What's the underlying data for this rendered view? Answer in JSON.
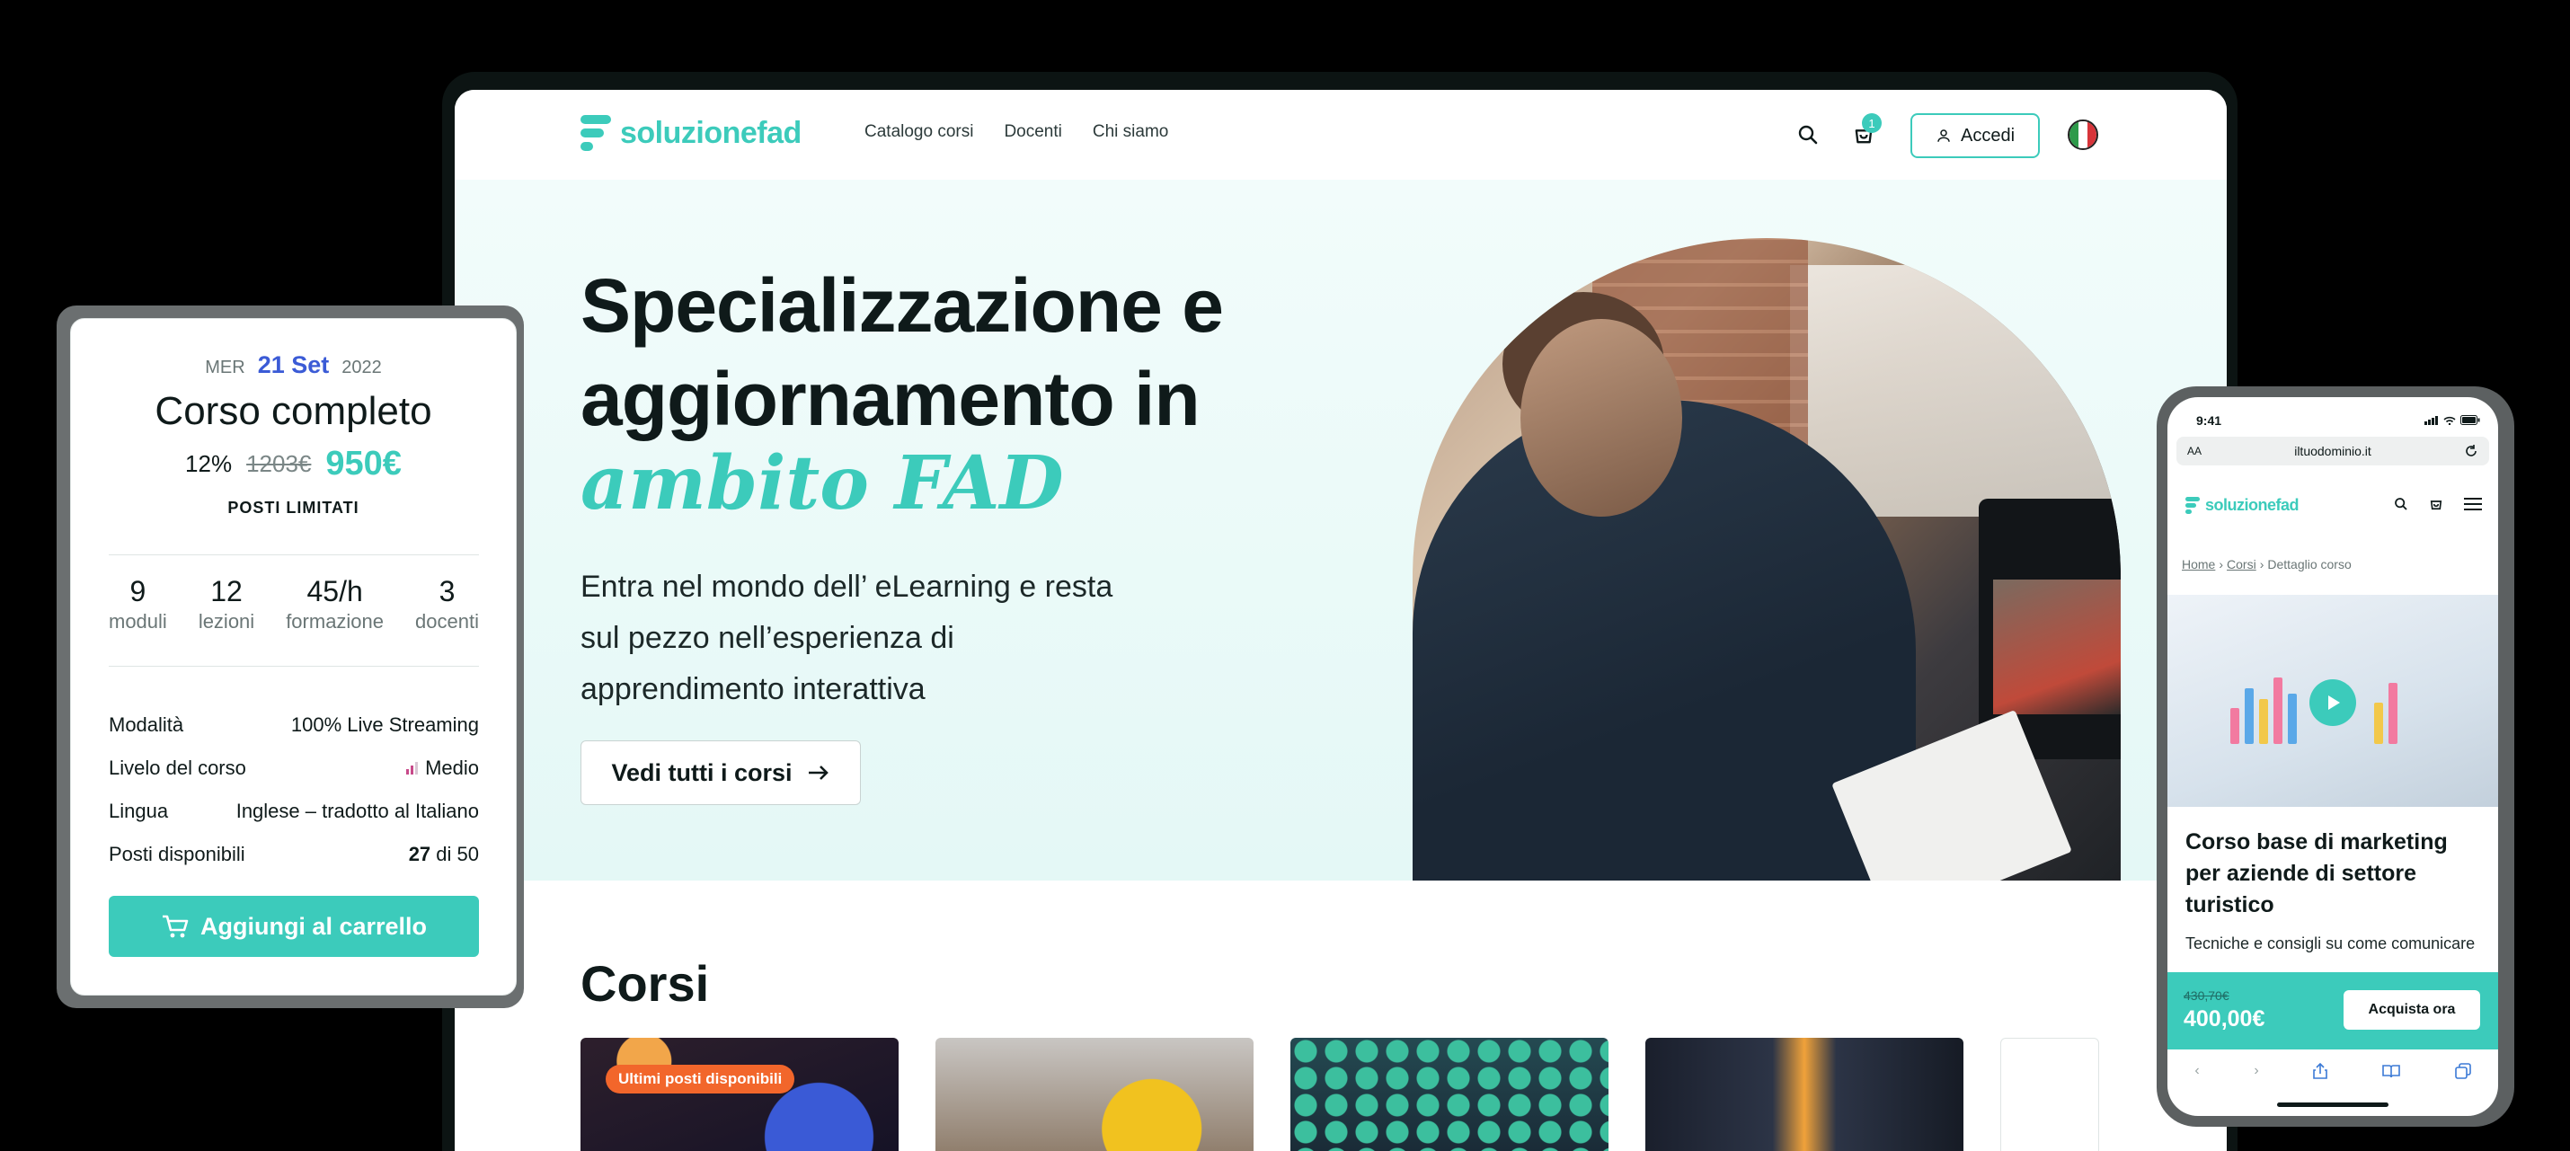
{
  "colors": {
    "accent": "#3ccbbb",
    "date_accent": "#3b5bd6",
    "badge": "#f2662b",
    "level": "#c84a8a"
  },
  "desktop": {
    "brand": "soluzionefad",
    "nav": [
      "Catalogo corsi",
      "Docenti",
      "Chi siamo"
    ],
    "cart_count": "1",
    "login_label": "Accedi",
    "hero": {
      "title": "Specializzazione e aggiornamento in",
      "accent": "ambito FAD",
      "subtitle": "Entra nel mondo dell’ eLearning e resta sul pezzo nell’esperienza di apprendimento interattiva",
      "cta": "Vedi tutti i corsi"
    },
    "courses_title": "Corsi",
    "course_badge": "Ultimi posti disponibili"
  },
  "course_card": {
    "date_dow": "MER",
    "date_day": "21 Set",
    "date_year": "2022",
    "title": "Corso completo",
    "discount": "12%",
    "old_price": "1203€",
    "new_price": "950€",
    "limited": "POSTI LIMITATI",
    "stats": [
      {
        "num": "9",
        "label": "moduli"
      },
      {
        "num": "12",
        "label": "lezioni"
      },
      {
        "num": "45/h",
        "label": "formazione"
      },
      {
        "num": "3",
        "label": "docenti"
      }
    ],
    "info": [
      {
        "label": "Modalità",
        "value": "100% Live Streaming"
      },
      {
        "label": "Livelo del corso",
        "value": "Medio"
      },
      {
        "label": "Lingua",
        "value": "Inglese – tradotto al Italiano"
      },
      {
        "label": "Posti disponibili",
        "value_bold": "27",
        "value_rest": " di 50"
      }
    ],
    "add_to_cart": "Aggiungi al carrello"
  },
  "phone": {
    "time": "9:41",
    "url_aa": "AA",
    "url": "iltuodominio.it",
    "brand": "soluzionefad",
    "breadcrumb": [
      "Home",
      "Corsi",
      "Dettaglio corso"
    ],
    "course_title": "Corso base di marketing per aziende di settore turistico",
    "course_desc": "Tecniche e consigli su come comunicare",
    "old_price": "430,70€",
    "new_price": "400,00€",
    "buy_label": "Acquista ora"
  }
}
